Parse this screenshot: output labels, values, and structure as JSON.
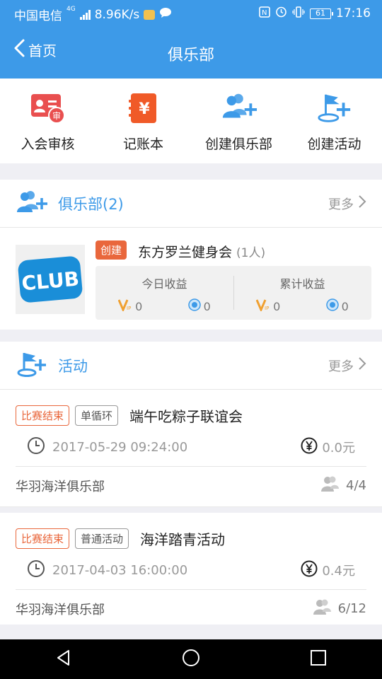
{
  "status_bar": {
    "carrier": "中国电信",
    "network": "4G",
    "speed": "8.96K/s",
    "battery": "61",
    "time": "17:16"
  },
  "header": {
    "back_label": "首页",
    "title": "俱乐部"
  },
  "quick_actions": [
    {
      "label": "入会审核",
      "icon": "member-review-icon",
      "badge": "审"
    },
    {
      "label": "记账本",
      "icon": "account-book-icon",
      "glyph": "¥"
    },
    {
      "label": "创建俱乐部",
      "icon": "create-club-icon"
    },
    {
      "label": "创建活动",
      "icon": "create-activity-icon"
    }
  ],
  "clubs_section": {
    "title": "俱乐部(2)",
    "more": "更多",
    "items": [
      {
        "logo_text": "CLUB",
        "tag": "创建",
        "name": "东方罗兰健身会",
        "member_count": "(1人)",
        "today_label": "今日收益",
        "total_label": "累计收益",
        "today_vip": "0",
        "today_coin": "0",
        "total_vip": "0",
        "total_coin": "0"
      }
    ]
  },
  "activities_section": {
    "title": "活动",
    "more": "更多",
    "items": [
      {
        "status": "比赛结束",
        "type": "单循环",
        "name": "端午吃粽子联谊会",
        "time": "2017-05-29 09:24:00",
        "fee": "0.0元",
        "club": "华羽海洋俱乐部",
        "participants": "4/4"
      },
      {
        "status": "比赛结束",
        "type": "普通活动",
        "name": "海洋踏青活动",
        "time": "2017-04-03 16:00:00",
        "fee": "0.4元",
        "club": "华羽海洋俱乐部",
        "participants": "6/12"
      }
    ]
  },
  "colors": {
    "primary": "#3d9ae8",
    "accent_red": "#e9673c",
    "vip_orange": "#f0a030"
  }
}
